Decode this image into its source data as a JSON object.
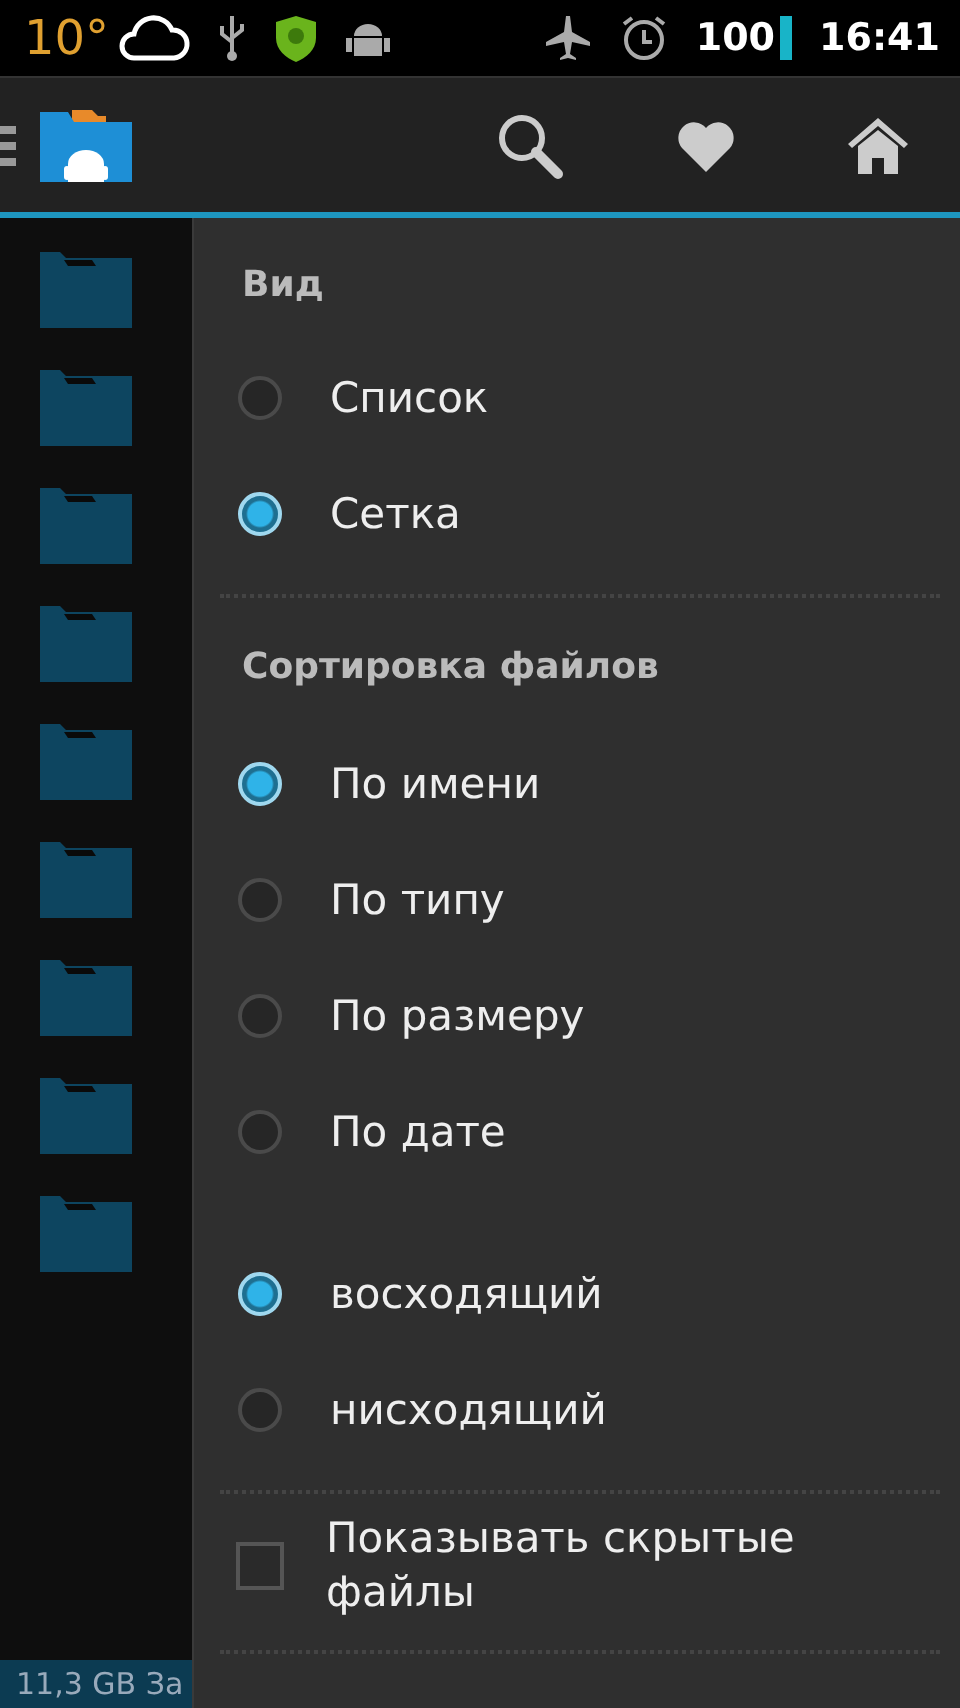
{
  "status_bar": {
    "temperature": "10°",
    "battery": "100",
    "time": "16:41"
  },
  "file_list": {
    "rows": [
      {
        "kind": "folder"
      },
      {
        "kind": "folder"
      },
      {
        "kind": "folder"
      },
      {
        "kind": "folder"
      },
      {
        "kind": "folder"
      },
      {
        "kind": "folder"
      },
      {
        "kind": "folder"
      },
      {
        "kind": "folder"
      },
      {
        "kind": "folder"
      }
    ]
  },
  "footer": {
    "storage": "11,3 GB За"
  },
  "menu": {
    "sections": [
      {
        "title": "Вид",
        "options": [
          {
            "label": "Список",
            "selected": false
          },
          {
            "label": "Сетка",
            "selected": true
          }
        ]
      },
      {
        "title": "Сортировка файлов",
        "options": [
          {
            "label": "По имени",
            "selected": true
          },
          {
            "label": "По типу",
            "selected": false
          },
          {
            "label": "По размеру",
            "selected": false
          },
          {
            "label": "По дате",
            "selected": false
          }
        ]
      },
      {
        "options": [
          {
            "label": "восходящий",
            "selected": true
          },
          {
            "label": "нисходящий",
            "selected": false
          }
        ]
      }
    ],
    "checkbox": {
      "label": "Показывать скрытые файлы",
      "checked": false
    }
  }
}
